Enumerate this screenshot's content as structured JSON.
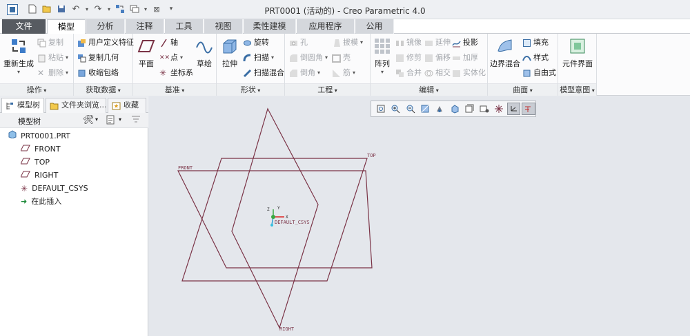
{
  "window": {
    "title": "PRT0001 (活动的) - Creo Parametric 4.0"
  },
  "tabs": [
    {
      "label": "文件"
    },
    {
      "label": "模型"
    },
    {
      "label": "分析"
    },
    {
      "label": "注释"
    },
    {
      "label": "工具"
    },
    {
      "label": "视图"
    },
    {
      "label": "柔性建模"
    },
    {
      "label": "应用程序"
    },
    {
      "label": "公用"
    }
  ],
  "ribbon": {
    "operations": {
      "label": "操作",
      "regenerate": "重新生成",
      "copy": "复制",
      "paste": "粘贴",
      "delete": "删除"
    },
    "get_data": {
      "label": "获取数据",
      "udf": "用户定义特征",
      "copy_geom": "复制几何",
      "shrinkwrap": "收缩包络"
    },
    "datum": {
      "label": "基准",
      "plane": "平面",
      "axis": "轴",
      "point": "点",
      "csys": "坐标系",
      "sketch": "草绘"
    },
    "shapes": {
      "label": "形状",
      "extrude": "拉伸",
      "revolve": "旋转",
      "sweep": "扫描",
      "swept_blend": "扫描混合"
    },
    "engineering": {
      "label": "工程",
      "hole": "孔",
      "draft": "拔模",
      "round": "倒圆角",
      "shell": "壳",
      "chamfer": "倒角",
      "rib": "筋"
    },
    "editing": {
      "label": "编辑",
      "pattern": "阵列",
      "mirror": "镜像",
      "extend": "延伸",
      "project": "投影",
      "trim": "修剪",
      "offset": "偏移",
      "thicken": "加厚",
      "merge": "合并",
      "intersect": "相交",
      "solidify": "实体化"
    },
    "surfaces": {
      "label": "曲面",
      "boundary_blend": "边界混合",
      "fill": "填充",
      "style": "样式",
      "freestyle": "自由式"
    },
    "model_intent": {
      "label": "模型意图",
      "component_interface": "元件界面"
    }
  },
  "left_panel": {
    "tabs": [
      {
        "label": "模型树"
      },
      {
        "label": "文件夹浏览..."
      },
      {
        "label": "收藏夹"
      }
    ],
    "header": "模型树",
    "tree": [
      {
        "label": "PRT0001.PRT",
        "icon": "part-icon"
      },
      {
        "label": "FRONT",
        "icon": "datum-plane-icon"
      },
      {
        "label": "TOP",
        "icon": "datum-plane-icon"
      },
      {
        "label": "RIGHT",
        "icon": "datum-plane-icon"
      },
      {
        "label": "DEFAULT_CSYS",
        "icon": "csys-icon"
      },
      {
        "label": "在此插入",
        "icon": "insert-arrow-icon"
      }
    ]
  },
  "viewport": {
    "planes": {
      "front": "FRONT",
      "top": "TOP",
      "right": "RIGHT"
    },
    "csys": {
      "label": "DEFAULT_CSYS",
      "x": "X",
      "y": "Y",
      "z": "Z"
    },
    "plane_color": "#7a3346"
  },
  "colors": {
    "file_tab": "#575b61",
    "accent": "#3a6ea5"
  }
}
